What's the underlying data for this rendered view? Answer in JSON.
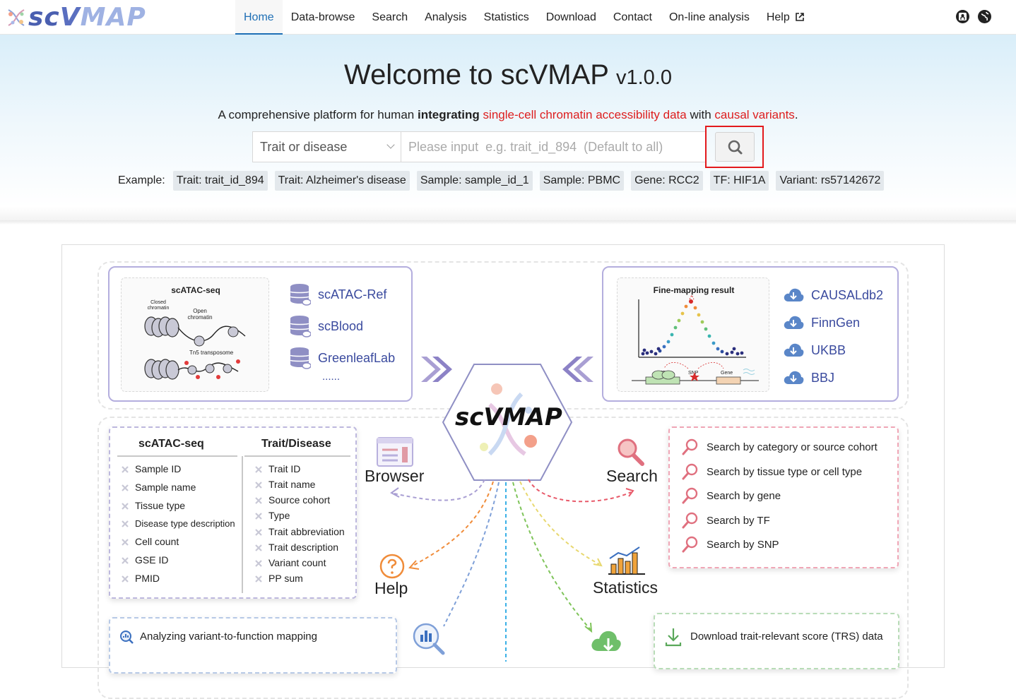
{
  "brand": {
    "sc": "sc",
    "v": "V",
    "map": "MAP"
  },
  "nav": {
    "items": [
      "Home",
      "Data-browse",
      "Search",
      "Analysis",
      "Statistics",
      "Download",
      "Contact",
      "On-line analysis",
      "Help"
    ],
    "active": "Home",
    "icons": [
      "github-icon",
      "globe-icon"
    ]
  },
  "hero": {
    "title": "Welcome to scVMAP",
    "version": "v1.0.0",
    "subtitle_a": "A comprehensive platform for human ",
    "subtitle_b": "integrating",
    "subtitle_c": " ",
    "subtitle_d": "single-cell chromatin accessibility data",
    "subtitle_e": " with ",
    "subtitle_f": "causal variants",
    "subtitle_g": ".",
    "colors": {
      "accent_red": "#dd1e1e",
      "nav_active": "#1f6fb5"
    }
  },
  "search": {
    "select_value": "Trait or disease",
    "placeholder": "Please input  e.g. trait_id_894  (Default to all)",
    "button_icon": "search-icon"
  },
  "examples": {
    "label": "Example:",
    "tags": [
      "Trait: trait_id_894",
      "Trait: Alzheimer's disease",
      "Sample: sample_id_1",
      "Sample: PBMC",
      "Gene: RCC2",
      "TF: HIF1A",
      "Variant: rs57142672"
    ]
  },
  "figure": {
    "left_box": {
      "diagram_title": "scATAC-seq",
      "labels": {
        "closed": "Closed chromatin",
        "open": "Open chromatin",
        "tn5": "Tn5 transposome"
      },
      "sources": [
        "scATAC-Ref",
        "scBlood",
        "GreenleafLab"
      ],
      "more": "......"
    },
    "right_box": {
      "diagram_title": "Fine-mapping result",
      "labels": {
        "tf": "TF",
        "snp": "SNP",
        "gene": "Gene"
      },
      "sources": [
        "CAUSALdb2",
        "FinnGen",
        "UKBB",
        "BBJ"
      ]
    },
    "center_logo": "scVMAP",
    "browser_card": {
      "col1_title": "scATAC-seq",
      "col1": [
        "Sample ID",
        "Sample name",
        "Tissue type",
        "Disease type description",
        "Cell count",
        "GSE ID",
        "PMID"
      ],
      "col2_title": "Trait/Disease",
      "col2": [
        "Trait ID",
        "Trait name",
        "Source cohort",
        "Type",
        "Trait abbreviation",
        "Trait description",
        "Variant count",
        "PP sum"
      ]
    },
    "search_card": [
      "Search by category or source cohort",
      "Search by tissue type or cell type",
      "Search by gene",
      "Search by TF",
      "Search by SNP"
    ],
    "modules": {
      "browser": "Browser",
      "search": "Search",
      "help": "Help",
      "statistics": "Statistics"
    },
    "analysis_card": "Analyzing variant-to-function mapping",
    "download_card": "Download trait-relevant score (TRS) data"
  }
}
